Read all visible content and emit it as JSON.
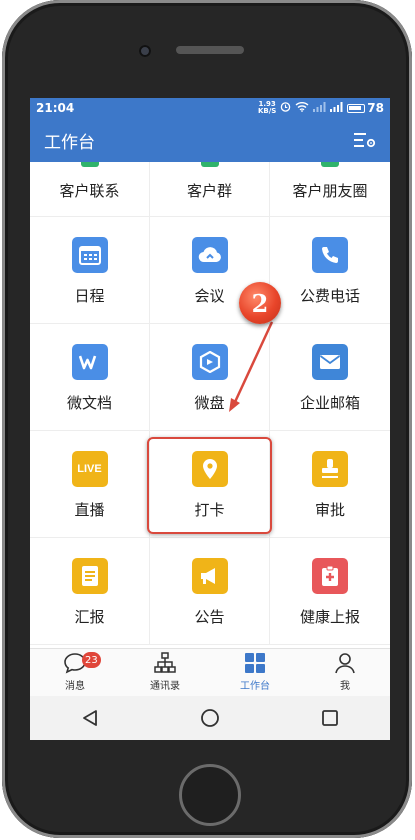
{
  "status_bar": {
    "time": "21:04",
    "speed_value": "1.93",
    "speed_unit": "KB/S",
    "battery": "78"
  },
  "app_bar": {
    "title": "工作台"
  },
  "grid": {
    "row0": [
      "客户联系",
      "客户群",
      "客户朋友圈"
    ],
    "row1": [
      {
        "label": "日程",
        "icon": "calendar-icon",
        "color": "#4a8ee6"
      },
      {
        "label": "会议",
        "icon": "cloud-icon",
        "color": "#4a8ee6"
      },
      {
        "label": "公费电话",
        "icon": "phone-icon",
        "color": "#4a8ee6"
      }
    ],
    "row2": [
      {
        "label": "微文档",
        "icon": "w-doc-icon",
        "color": "#4a8ee6"
      },
      {
        "label": "微盘",
        "icon": "drive-icon",
        "color": "#4a8ee6"
      },
      {
        "label": "企业邮箱",
        "icon": "mail-icon",
        "color": "#3f86d8"
      }
    ],
    "row3": [
      {
        "label": "直播",
        "icon": "live-icon",
        "icon_text": "LIVE",
        "color": "#f0b418"
      },
      {
        "label": "打卡",
        "icon": "location-pin-icon",
        "color": "#f0b418"
      },
      {
        "label": "审批",
        "icon": "stamp-icon",
        "color": "#f0b418"
      }
    ],
    "row4": [
      {
        "label": "汇报",
        "icon": "report-icon",
        "color": "#f0b418"
      },
      {
        "label": "公告",
        "icon": "megaphone-icon",
        "color": "#f0b418"
      },
      {
        "label": "健康上报",
        "icon": "health-icon",
        "color": "#e8575a"
      }
    ]
  },
  "annotation": {
    "step_number": "2",
    "color": "#d9493d"
  },
  "tabs": [
    {
      "label": "消息",
      "badge": "23",
      "icon": "chat-bubble-icon"
    },
    {
      "label": "通讯录",
      "icon": "org-chart-icon"
    },
    {
      "label": "工作台",
      "icon": "grid-icon",
      "active": true
    },
    {
      "label": "我",
      "icon": "person-icon"
    }
  ],
  "colors": {
    "primary": "#3d78c9",
    "active_tab": "#3d78c9"
  }
}
